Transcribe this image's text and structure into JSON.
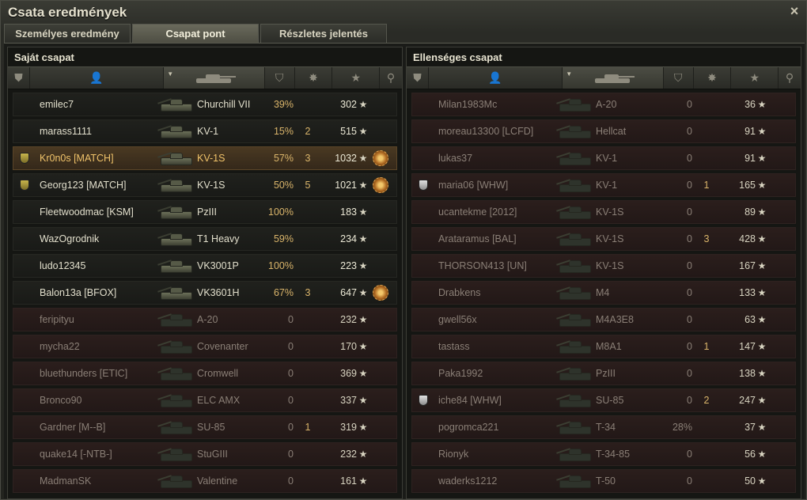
{
  "window": {
    "title": "Csata eredmények",
    "close_icon": "×"
  },
  "tabs": [
    {
      "label": "Személyes eredmény",
      "active": false
    },
    {
      "label": "Csapat pont",
      "active": true
    },
    {
      "label": "Részletes jelentés",
      "active": false
    }
  ],
  "icons": {
    "header_medal": "⛊",
    "header_player": "👤",
    "header_surv": "⛉",
    "header_kills": "✸",
    "header_xp": "★",
    "header_award": "⚲",
    "star": "★"
  },
  "colors": {
    "platoon_text": "#f0c36a",
    "dead_text": "#8a7f76",
    "accent_orange": "#d9b46a"
  },
  "teams": {
    "own": {
      "title": "Saját csapat",
      "rows": [
        {
          "name": "emilec7",
          "tank": "Churchill VII",
          "surv": "39%",
          "kills": "",
          "xp": "302",
          "state": "alive",
          "medal": "",
          "award": false
        },
        {
          "name": "marass1111",
          "tank": "KV-1",
          "surv": "15%",
          "kills": "2",
          "xp": "515",
          "state": "alive",
          "medal": "",
          "award": false
        },
        {
          "name": "Kr0n0s [MATCH]",
          "tank": "KV-1S",
          "surv": "57%",
          "kills": "3",
          "xp": "1032",
          "state": "platoon",
          "medal": "gold",
          "award": true
        },
        {
          "name": "Georg123 [MATCH]",
          "tank": "KV-1S",
          "surv": "50%",
          "kills": "5",
          "xp": "1021",
          "state": "alive-platoon",
          "medal": "gold",
          "award": true
        },
        {
          "name": "Fleetwoodmac [KSM]",
          "tank": "PzIII",
          "surv": "100%",
          "kills": "",
          "xp": "183",
          "state": "alive",
          "medal": "",
          "award": false
        },
        {
          "name": "WazOgrodnik",
          "tank": "T1 Heavy",
          "surv": "59%",
          "kills": "",
          "xp": "234",
          "state": "alive",
          "medal": "",
          "award": false
        },
        {
          "name": "ludo12345",
          "tank": "VK3001P",
          "surv": "100%",
          "kills": "",
          "xp": "223",
          "state": "alive",
          "medal": "",
          "award": false
        },
        {
          "name": "Balon13a [BFOX]",
          "tank": "VK3601H",
          "surv": "67%",
          "kills": "3",
          "xp": "647",
          "state": "alive",
          "medal": "",
          "award": true
        },
        {
          "name": "feripityu",
          "tank": "A-20",
          "surv": "0",
          "kills": "",
          "xp": "232",
          "state": "dead",
          "medal": "",
          "award": false
        },
        {
          "name": "mycha22",
          "tank": "Covenanter",
          "surv": "0",
          "kills": "",
          "xp": "170",
          "state": "dead",
          "medal": "",
          "award": false
        },
        {
          "name": "bluethunders [ETIC]",
          "tank": "Cromwell",
          "surv": "0",
          "kills": "",
          "xp": "369",
          "state": "dead",
          "medal": "",
          "award": false
        },
        {
          "name": "Bronco90",
          "tank": "ELC AMX",
          "surv": "0",
          "kills": "",
          "xp": "337",
          "state": "dead",
          "medal": "",
          "award": false
        },
        {
          "name": "Gardner [M--B]",
          "tank": "SU-85",
          "surv": "0",
          "kills": "1",
          "xp": "319",
          "state": "dead",
          "medal": "",
          "award": false
        },
        {
          "name": "quake14 [-NTB-]",
          "tank": "StuGIII",
          "surv": "0",
          "kills": "",
          "xp": "232",
          "state": "dead",
          "medal": "",
          "award": false
        },
        {
          "name": "MadmanSK",
          "tank": "Valentine",
          "surv": "0",
          "kills": "",
          "xp": "161",
          "state": "dead",
          "medal": "",
          "award": false
        }
      ]
    },
    "enemy": {
      "title": "Ellenséges csapat",
      "rows": [
        {
          "name": "Milan1983Mc",
          "tank": "A-20",
          "surv": "0",
          "kills": "",
          "xp": "36",
          "state": "dead",
          "medal": "",
          "award": false
        },
        {
          "name": "moreau13300 [LCFD]",
          "tank": "Hellcat",
          "surv": "0",
          "kills": "",
          "xp": "91",
          "state": "dead",
          "medal": "",
          "award": false
        },
        {
          "name": "lukas37",
          "tank": "KV-1",
          "surv": "0",
          "kills": "",
          "xp": "91",
          "state": "dead",
          "medal": "",
          "award": false
        },
        {
          "name": "maria06 [WHW]",
          "tank": "KV-1",
          "surv": "0",
          "kills": "1",
          "xp": "165",
          "state": "dead",
          "medal": "silver",
          "award": false
        },
        {
          "name": "ucantekme [2012]",
          "tank": "KV-1S",
          "surv": "0",
          "kills": "",
          "xp": "89",
          "state": "dead",
          "medal": "",
          "award": false
        },
        {
          "name": "Arataramus [BAL]",
          "tank": "KV-1S",
          "surv": "0",
          "kills": "3",
          "xp": "428",
          "state": "dead",
          "medal": "",
          "award": false
        },
        {
          "name": "THORSON413 [UN]",
          "tank": "KV-1S",
          "surv": "0",
          "kills": "",
          "xp": "167",
          "state": "dead",
          "medal": "",
          "award": false
        },
        {
          "name": "Drabkens",
          "tank": "M4",
          "surv": "0",
          "kills": "",
          "xp": "133",
          "state": "dead",
          "medal": "",
          "award": false
        },
        {
          "name": "gwell56x",
          "tank": "M4A3E8",
          "surv": "0",
          "kills": "",
          "xp": "63",
          "state": "dead",
          "medal": "",
          "award": false
        },
        {
          "name": "tastass",
          "tank": "M8A1",
          "surv": "0",
          "kills": "1",
          "xp": "147",
          "state": "dead",
          "medal": "",
          "award": false
        },
        {
          "name": "Paka1992",
          "tank": "PzIII",
          "surv": "0",
          "kills": "",
          "xp": "138",
          "state": "dead",
          "medal": "",
          "award": false
        },
        {
          "name": "iche84 [WHW]",
          "tank": "SU-85",
          "surv": "0",
          "kills": "2",
          "xp": "247",
          "state": "dead",
          "medal": "silver",
          "award": false
        },
        {
          "name": "pogromca221",
          "tank": "T-34",
          "surv": "28%",
          "kills": "",
          "xp": "37",
          "state": "dead",
          "medal": "",
          "award": false
        },
        {
          "name": "Rionyk",
          "tank": "T-34-85",
          "surv": "0",
          "kills": "",
          "xp": "56",
          "state": "dead",
          "medal": "",
          "award": false
        },
        {
          "name": "waderks1212",
          "tank": "T-50",
          "surv": "0",
          "kills": "",
          "xp": "50",
          "state": "dead",
          "medal": "",
          "award": false
        }
      ]
    }
  }
}
